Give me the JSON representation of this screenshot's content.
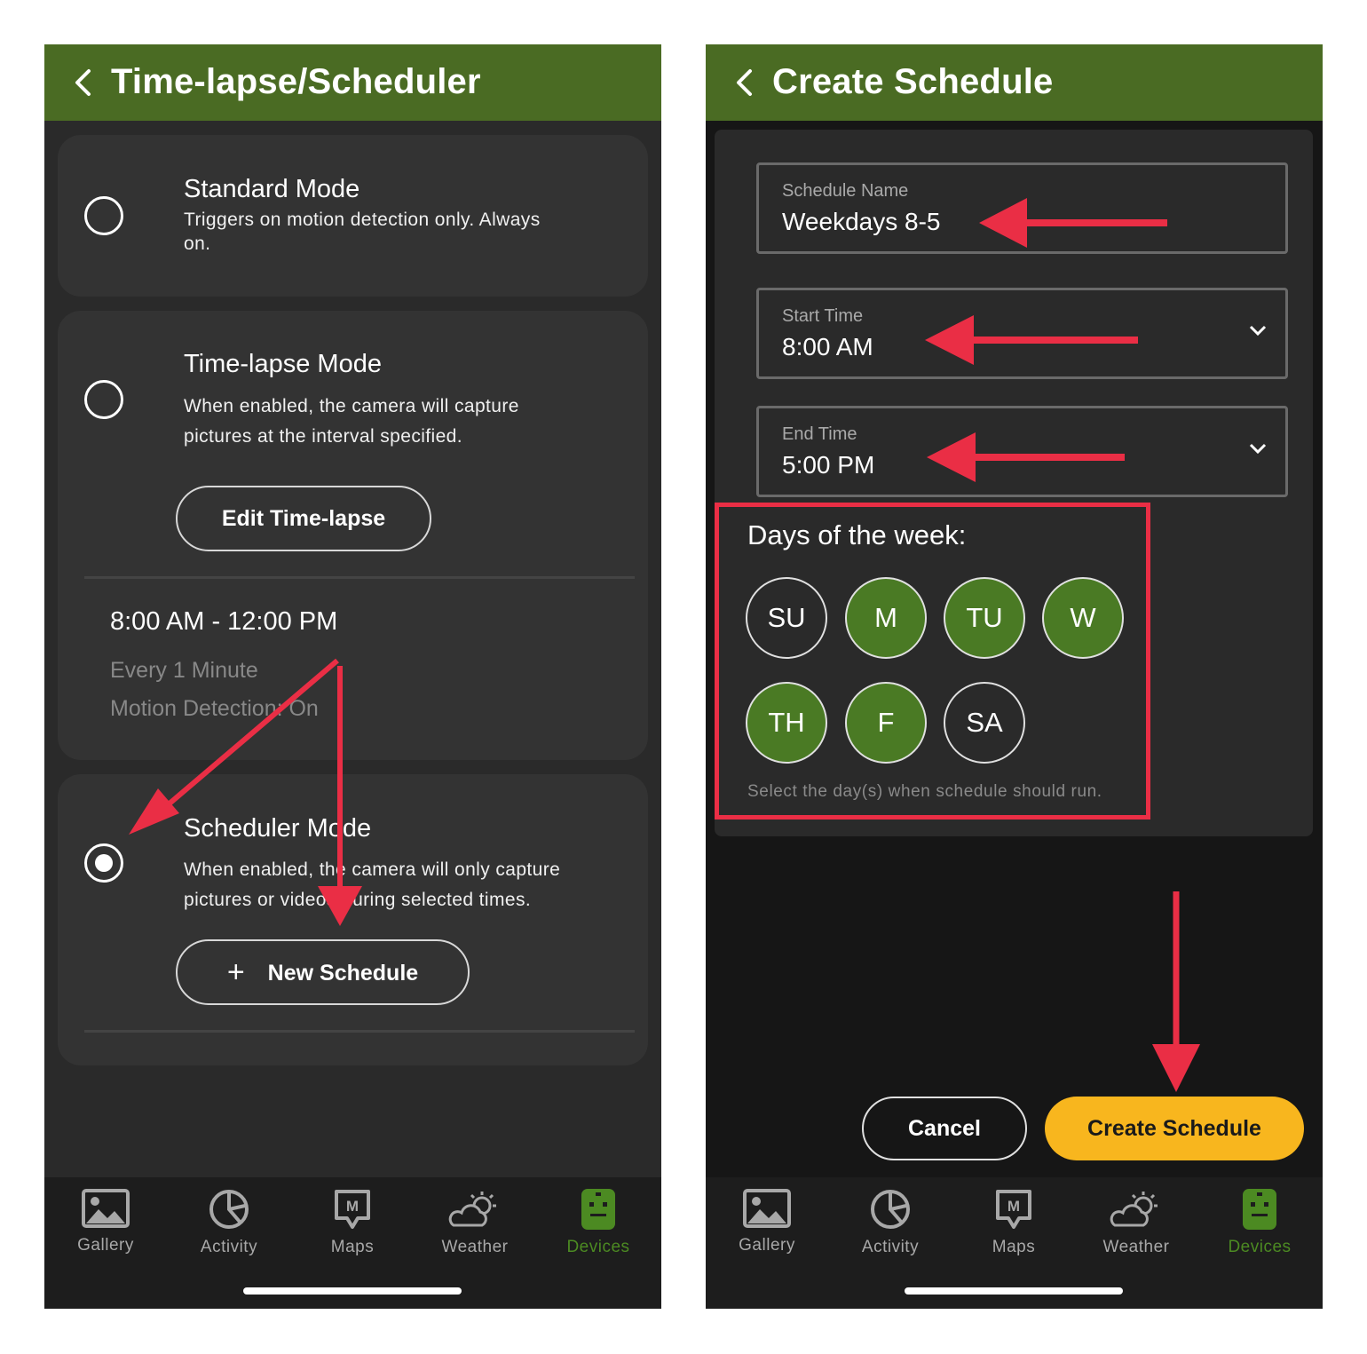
{
  "left_screen": {
    "header": {
      "title": "Time-lapse/Scheduler"
    },
    "standard_mode": {
      "title": "Standard Mode",
      "desc_line1": "Triggers on motion detection only. Always",
      "desc_line2": "on.",
      "selected": false
    },
    "timelapse_mode": {
      "title": "Time-lapse Mode",
      "desc_line1": "When enabled, the camera will capture",
      "desc_line2": "pictures at the interval specified.",
      "button": "Edit Time-lapse",
      "selected": false,
      "schedule": {
        "time_range": "8:00 AM - 12:00 PM",
        "interval": "Every 1 Minute",
        "motion": "Motion Detection: On"
      }
    },
    "scheduler_mode": {
      "title": "Scheduler Mode",
      "desc_line1": "When enabled, the camera will only capture",
      "desc_line2": "pictures or videos during selected times.",
      "button": "New Schedule",
      "selected": true
    }
  },
  "right_screen": {
    "header": {
      "title": "Create Schedule"
    },
    "schedule_name": {
      "label": "Schedule Name",
      "value": "Weekdays 8-5"
    },
    "start_time": {
      "label": "Start Time",
      "value": "8:00 AM"
    },
    "end_time": {
      "label": "End Time",
      "value": "5:00 PM"
    },
    "days": {
      "title": "Days of the week:",
      "help": "Select the day(s) when schedule should run.",
      "items": [
        {
          "label": "SU",
          "selected": false
        },
        {
          "label": "M",
          "selected": true
        },
        {
          "label": "TU",
          "selected": true
        },
        {
          "label": "W",
          "selected": true
        },
        {
          "label": "TH",
          "selected": true
        },
        {
          "label": "F",
          "selected": true
        },
        {
          "label": "SA",
          "selected": false
        }
      ]
    },
    "cancel_label": "Cancel",
    "create_label": "Create Schedule"
  },
  "nav": {
    "items": [
      {
        "label": "Gallery",
        "icon": "gallery-icon"
      },
      {
        "label": "Activity",
        "icon": "activity-icon"
      },
      {
        "label": "Maps",
        "icon": "maps-icon"
      },
      {
        "label": "Weather",
        "icon": "weather-icon"
      },
      {
        "label": "Devices",
        "icon": "devices-icon",
        "active": true
      }
    ]
  },
  "colors": {
    "header_green": "#4a6b23",
    "selected_day_green": "#4a7a24",
    "active_nav_green": "#4c8a22",
    "create_button_yellow": "#f8b61e",
    "annotation_red": "#ea2e45"
  }
}
